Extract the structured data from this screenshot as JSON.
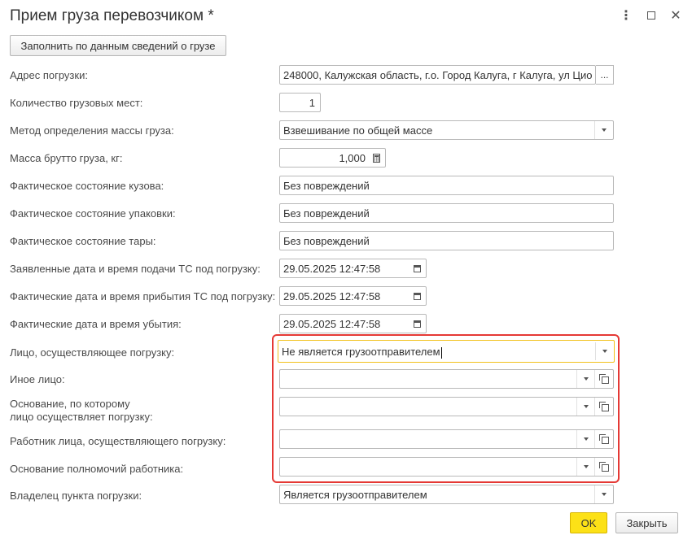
{
  "window": {
    "title": "Прием груза перевозчиком *"
  },
  "toolbar": {
    "fill_label": "Заполнить по данным сведений о грузе"
  },
  "fields": {
    "loading_address": {
      "label": "Адрес погрузки:",
      "value": "248000, Калужская область, г.о. Город Калуга, г Калуга, ул Цио",
      "button": "..."
    },
    "cargo_places": {
      "label": "Количество грузовых мест:",
      "value": "1"
    },
    "mass_method": {
      "label": "Метод определения массы груза:",
      "value": "Взвешивание по общей массе"
    },
    "gross_mass": {
      "label": "Масса брутто груза, кг:",
      "value": "1,000"
    },
    "body_state": {
      "label": "Фактическое состояние кузова:",
      "value": "Без повреждений"
    },
    "package_state": {
      "label": "Фактическое состояние упаковки:",
      "value": "Без повреждений"
    },
    "container_state": {
      "label": "Фактическое состояние тары:",
      "value": "Без повреждений"
    },
    "declared_datetime": {
      "label": "Заявленные дата и время подачи ТС под погрузку:",
      "value": "29.05.2025 12:47:58"
    },
    "arrival_datetime": {
      "label": "Фактические дата и время прибытия ТС под погрузку:",
      "value": "29.05.2025 12:47:58"
    },
    "departure_datetime": {
      "label": "Фактические дата и время убытия:",
      "value": "29.05.2025 12:47:58"
    },
    "loading_person": {
      "label": "Лицо, осуществляющее погрузку:",
      "value": "Не является грузоотправителем"
    },
    "other_person": {
      "label": "Иное лицо:",
      "value": ""
    },
    "basis_line1": "Основание, по которому",
    "basis_line2": "лицо осуществляет погрузку:",
    "basis_value": "",
    "worker": {
      "label": "Работник лица, осуществляющего погрузку:",
      "value": ""
    },
    "worker_authority": {
      "label": "Основание полномочий работника:",
      "value": ""
    },
    "point_owner": {
      "label": "Владелец пункта погрузки:",
      "value": "Является грузоотправителем"
    }
  },
  "footer": {
    "ok_label": "OK",
    "close_label": "Закрыть"
  },
  "colors": {
    "highlight": "#e53935",
    "ok_button": "#fce117",
    "focus_border": "#f2c11a"
  }
}
